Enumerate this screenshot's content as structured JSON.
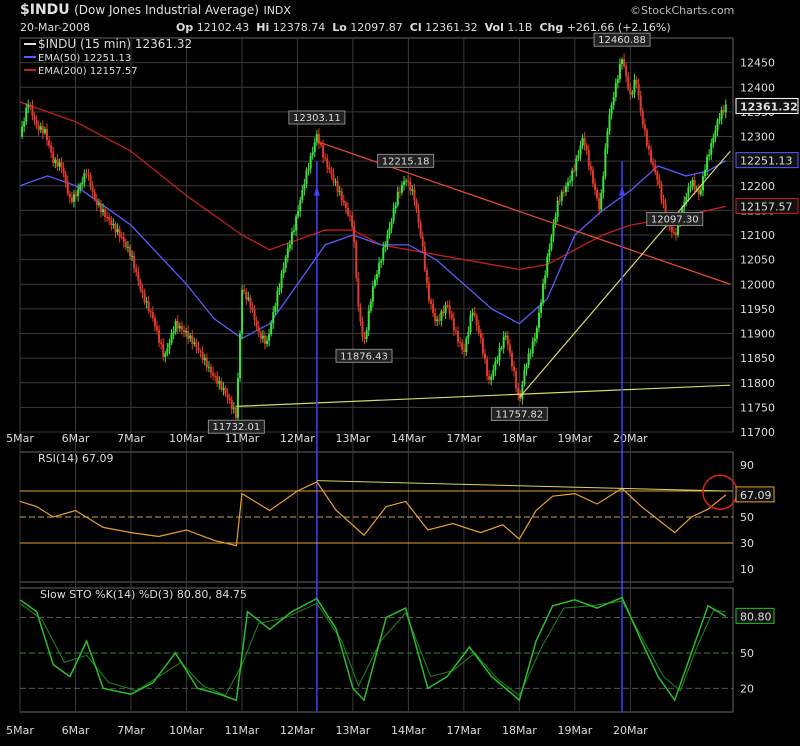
{
  "header": {
    "symbol": "$INDU",
    "name": "(Dow Jones Industrial Average)",
    "exchange": "INDX",
    "date": "20-Mar-2008",
    "op_label": "Op",
    "op": "12102.43",
    "hi_label": "Hi",
    "hi": "12378.74",
    "lo_label": "Lo",
    "lo": "12097.87",
    "cl_label": "Cl",
    "cl": "12361.32",
    "vol_label": "Vol",
    "vol": "1.1B",
    "chg_label": "Chg",
    "chg": "+261.66 (+2.16%)",
    "brand": "©StockCharts.com"
  },
  "colors": {
    "up": "#3fe13f",
    "down": "#e23b2b",
    "ema50": "#5a5aff",
    "ema200": "#c41e1e",
    "trend_red": "#e84b36",
    "trend_yellow": "#d6d66a",
    "rsi": "#e6a030",
    "sto": "#2bbf2b",
    "grid": "#3a3a3a",
    "vline": "#4040ff"
  },
  "chart_data": [
    {
      "type": "candlestick",
      "title": "$INDU (15 min) 12361.32",
      "legend": [
        {
          "label": "$INDU (15 min) 12361.32"
        },
        {
          "label": "EMA(50) 12251.13"
        },
        {
          "label": "EMA(200) 12157.57"
        }
      ],
      "x_tick_labels": [
        "5Mar",
        "6Mar",
        "7Mar",
        "10Mar",
        "11Mar",
        "12Mar",
        "13Mar",
        "14Mar",
        "17Mar",
        "18Mar",
        "19Mar",
        "20Mar"
      ],
      "ylim": [
        11700,
        12500
      ],
      "y_ticks": [
        11700,
        11750,
        11800,
        11850,
        11900,
        11950,
        12000,
        12050,
        12100,
        12150,
        12200,
        12250,
        12300,
        12350,
        12400,
        12450
      ],
      "price_path": [
        [
          0,
          12300
        ],
        [
          0.15,
          12370
        ],
        [
          0.3,
          12320
        ],
        [
          0.45,
          12310
        ],
        [
          0.6,
          12250
        ],
        [
          0.75,
          12240
        ],
        [
          0.9,
          12170
        ],
        [
          1,
          12180
        ],
        [
          1.2,
          12230
        ],
        [
          1.35,
          12170
        ],
        [
          1.6,
          12130
        ],
        [
          1.8,
          12100
        ],
        [
          2,
          12060
        ],
        [
          2.2,
          11980
        ],
        [
          2.4,
          11930
        ],
        [
          2.6,
          11850
        ],
        [
          2.8,
          11920
        ],
        [
          3,
          11900
        ],
        [
          3.2,
          11870
        ],
        [
          3.45,
          11820
        ],
        [
          3.7,
          11780
        ],
        [
          3.9,
          11732
        ],
        [
          4,
          11990
        ],
        [
          4.15,
          11960
        ],
        [
          4.3,
          11900
        ],
        [
          4.45,
          11880
        ],
        [
          4.6,
          11960
        ],
        [
          4.8,
          12060
        ],
        [
          4.95,
          12120
        ],
        [
          5.15,
          12220
        ],
        [
          5.35,
          12303
        ],
        [
          5.5,
          12250
        ],
        [
          5.7,
          12200
        ],
        [
          5.85,
          12160
        ],
        [
          6,
          12120
        ],
        [
          6.1,
          11950
        ],
        [
          6.2,
          11876
        ],
        [
          6.35,
          11990
        ],
        [
          6.5,
          12050
        ],
        [
          6.65,
          12110
        ],
        [
          6.8,
          12180
        ],
        [
          6.95,
          12215
        ],
        [
          7.1,
          12180
        ],
        [
          7.25,
          12080
        ],
        [
          7.35,
          11980
        ],
        [
          7.5,
          11920
        ],
        [
          7.7,
          11960
        ],
        [
          7.85,
          11900
        ],
        [
          8,
          11860
        ],
        [
          8.15,
          11950
        ],
        [
          8.3,
          11890
        ],
        [
          8.45,
          11800
        ],
        [
          8.6,
          11850
        ],
        [
          8.75,
          11900
        ],
        [
          8.9,
          11820
        ],
        [
          9,
          11758
        ],
        [
          9.1,
          11830
        ],
        [
          9.3,
          11900
        ],
        [
          9.5,
          12050
        ],
        [
          9.7,
          12170
        ],
        [
          9.9,
          12210
        ],
        [
          10,
          12240
        ],
        [
          10.15,
          12300
        ],
        [
          10.3,
          12220
        ],
        [
          10.45,
          12150
        ],
        [
          10.6,
          12330
        ],
        [
          10.75,
          12410
        ],
        [
          10.85,
          12461
        ],
        [
          11,
          12380
        ],
        [
          11.1,
          12420
        ],
        [
          11.2,
          12340
        ],
        [
          11.35,
          12260
        ],
        [
          11.5,
          12210
        ],
        [
          11.65,
          12130
        ],
        [
          11.8,
          12097
        ],
        [
          11.95,
          12160
        ],
        [
          12.1,
          12210
        ],
        [
          12.25,
          12180
        ],
        [
          12.35,
          12240
        ],
        [
          12.5,
          12300
        ],
        [
          12.6,
          12340
        ],
        [
          12.72,
          12361
        ]
      ],
      "ema50_path": [
        [
          0,
          12200
        ],
        [
          0.5,
          12220
        ],
        [
          1,
          12200
        ],
        [
          1.5,
          12160
        ],
        [
          2,
          12120
        ],
        [
          2.5,
          12060
        ],
        [
          3,
          12000
        ],
        [
          3.5,
          11930
        ],
        [
          4,
          11890
        ],
        [
          4.5,
          11920
        ],
        [
          5,
          12000
        ],
        [
          5.5,
          12080
        ],
        [
          6,
          12100
        ],
        [
          6.5,
          12080
        ],
        [
          7,
          12080
        ],
        [
          7.5,
          12050
        ],
        [
          8,
          12000
        ],
        [
          8.5,
          11950
        ],
        [
          9,
          11920
        ],
        [
          9.5,
          11970
        ],
        [
          10,
          12100
        ],
        [
          10.5,
          12150
        ],
        [
          11,
          12190
        ],
        [
          11.5,
          12240
        ],
        [
          12,
          12220
        ],
        [
          12.4,
          12230
        ],
        [
          12.72,
          12251
        ]
      ],
      "ema200_path": [
        [
          0,
          12370
        ],
        [
          1,
          12330
        ],
        [
          2,
          12270
        ],
        [
          3,
          12180
        ],
        [
          4,
          12100
        ],
        [
          4.5,
          12070
        ],
        [
          5,
          12090
        ],
        [
          5.5,
          12110
        ],
        [
          6,
          12110
        ],
        [
          6.5,
          12080
        ],
        [
          7,
          12070
        ],
        [
          7.5,
          12060
        ],
        [
          8,
          12050
        ],
        [
          8.5,
          12040
        ],
        [
          9,
          12030
        ],
        [
          9.5,
          12040
        ],
        [
          10,
          12070
        ],
        [
          10.5,
          12100
        ],
        [
          11,
          12120
        ],
        [
          11.5,
          12130
        ],
        [
          12,
          12140
        ],
        [
          12.72,
          12158
        ]
      ],
      "annotations": [
        {
          "x": 3.9,
          "y": 11732,
          "label": "11732.01"
        },
        {
          "x": 5.35,
          "y": 12303,
          "label": "12303.11"
        },
        {
          "x": 6.2,
          "y": 11876,
          "label": "11876.43"
        },
        {
          "x": 6.95,
          "y": 12215,
          "label": "12215.18"
        },
        {
          "x": 9,
          "y": 11758,
          "label": "11757.82"
        },
        {
          "x": 10.85,
          "y": 12461,
          "label": "12460.88"
        },
        {
          "x": 11.8,
          "y": 12097,
          "label": "12097.30"
        }
      ],
      "right_tags": [
        {
          "y": 12361,
          "label": "12361.32"
        },
        {
          "y": 12251,
          "label": "12251.13"
        },
        {
          "y": 12158,
          "label": "12157.57"
        }
      ],
      "trendlines": [
        {
          "color": "trend_red",
          "from": [
            5.35,
            12290
          ],
          "to": [
            12.8,
            12000
          ]
        },
        {
          "color": "trend_yellow",
          "from": [
            3.9,
            11752
          ],
          "to": [
            12.8,
            11795
          ]
        },
        {
          "color": "trend_yellow",
          "from": [
            9,
            11770
          ],
          "to": [
            12.8,
            12270
          ]
        }
      ],
      "vertical_markers": [
        5.35,
        10.85
      ]
    },
    {
      "type": "line",
      "title": "RSI(14) 67.09",
      "ylim": [
        0,
        100
      ],
      "y_ticks": [
        10,
        30,
        50,
        70,
        90
      ],
      "reference_lines": [
        30,
        50,
        70
      ],
      "last_value_label": "67.09",
      "values": [
        [
          0,
          62
        ],
        [
          0.3,
          58
        ],
        [
          0.6,
          50
        ],
        [
          1,
          55
        ],
        [
          1.5,
          42
        ],
        [
          2,
          38
        ],
        [
          2.5,
          35
        ],
        [
          3,
          40
        ],
        [
          3.5,
          32
        ],
        [
          3.9,
          28
        ],
        [
          4,
          68
        ],
        [
          4.5,
          55
        ],
        [
          5,
          70
        ],
        [
          5.35,
          77
        ],
        [
          5.7,
          55
        ],
        [
          6.2,
          36
        ],
        [
          6.6,
          58
        ],
        [
          6.95,
          62
        ],
        [
          7.35,
          40
        ],
        [
          7.8,
          45
        ],
        [
          8.3,
          38
        ],
        [
          8.7,
          44
        ],
        [
          9,
          33
        ],
        [
          9.3,
          55
        ],
        [
          9.6,
          66
        ],
        [
          10,
          68
        ],
        [
          10.4,
          60
        ],
        [
          10.85,
          72
        ],
        [
          11.2,
          58
        ],
        [
          11.5,
          48
        ],
        [
          11.8,
          38
        ],
        [
          12.1,
          50
        ],
        [
          12.4,
          56
        ],
        [
          12.72,
          67
        ]
      ],
      "trendline": {
        "from": [
          5.35,
          78
        ],
        "to": [
          12.72,
          70
        ]
      }
    },
    {
      "type": "line",
      "title": "Slow STO %K(14) %D(3) 80.80, 84.75",
      "ylim": [
        0,
        105
      ],
      "y_ticks": [
        20,
        50,
        80
      ],
      "reference_lines": [
        20,
        50,
        80
      ],
      "last_value_label": "80.80",
      "k_values": [
        [
          0,
          95
        ],
        [
          0.3,
          85
        ],
        [
          0.6,
          40
        ],
        [
          0.9,
          30
        ],
        [
          1.2,
          60
        ],
        [
          1.5,
          20
        ],
        [
          2,
          15
        ],
        [
          2.4,
          25
        ],
        [
          2.8,
          50
        ],
        [
          3.2,
          20
        ],
        [
          3.6,
          15
        ],
        [
          3.9,
          10
        ],
        [
          4.1,
          85
        ],
        [
          4.5,
          70
        ],
        [
          4.9,
          85
        ],
        [
          5.35,
          96
        ],
        [
          5.7,
          70
        ],
        [
          6,
          20
        ],
        [
          6.2,
          10
        ],
        [
          6.6,
          80
        ],
        [
          6.95,
          88
        ],
        [
          7.35,
          20
        ],
        [
          7.7,
          30
        ],
        [
          8.1,
          55
        ],
        [
          8.5,
          30
        ],
        [
          9,
          10
        ],
        [
          9.3,
          60
        ],
        [
          9.6,
          90
        ],
        [
          10,
          95
        ],
        [
          10.4,
          88
        ],
        [
          10.85,
          97
        ],
        [
          11.2,
          60
        ],
        [
          11.5,
          30
        ],
        [
          11.8,
          10
        ],
        [
          12.1,
          50
        ],
        [
          12.4,
          90
        ],
        [
          12.72,
          81
        ]
      ],
      "d_values": [
        [
          0,
          92
        ],
        [
          0.4,
          78
        ],
        [
          0.8,
          42
        ],
        [
          1.2,
          48
        ],
        [
          1.6,
          25
        ],
        [
          2.1,
          18
        ],
        [
          2.5,
          30
        ],
        [
          2.9,
          42
        ],
        [
          3.3,
          22
        ],
        [
          3.7,
          14
        ],
        [
          4,
          40
        ],
        [
          4.3,
          75
        ],
        [
          4.8,
          80
        ],
        [
          5.35,
          92
        ],
        [
          5.8,
          60
        ],
        [
          6.1,
          22
        ],
        [
          6.5,
          60
        ],
        [
          6.95,
          84
        ],
        [
          7.4,
          30
        ],
        [
          7.8,
          35
        ],
        [
          8.2,
          50
        ],
        [
          8.6,
          28
        ],
        [
          9,
          14
        ],
        [
          9.4,
          55
        ],
        [
          9.8,
          88
        ],
        [
          10.3,
          90
        ],
        [
          10.85,
          94
        ],
        [
          11.3,
          55
        ],
        [
          11.6,
          30
        ],
        [
          11.9,
          18
        ],
        [
          12.2,
          55
        ],
        [
          12.5,
          86
        ],
        [
          12.72,
          85
        ]
      ]
    }
  ]
}
